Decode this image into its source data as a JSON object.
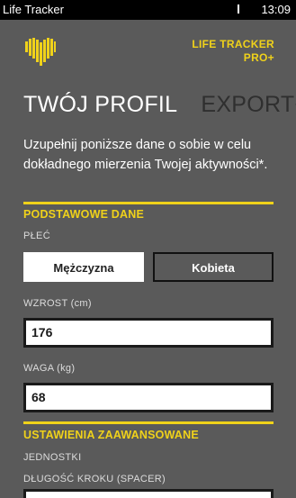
{
  "status_bar": {
    "app_title": "Life Tracker",
    "time": "13:09"
  },
  "brand": {
    "line1": "LIFE TRACKER",
    "line2": "PRO+"
  },
  "tabs": [
    {
      "label": "TWÓJ PROFIL",
      "active": true
    },
    {
      "label": "EXPORT+IMPORT",
      "active": false
    }
  ],
  "intro_text": "Uzupełnij poniższe dane o sobie w celu dokładnego mierzenia Twojej aktywności*.",
  "basic": {
    "section_title": "PODSTAWOWE DANE",
    "gender": {
      "label": "PŁEĆ",
      "male_label": "Mężczyzna",
      "female_label": "Kobieta",
      "selected": "Mężczyzna"
    },
    "height": {
      "label": "WZROST (cm)",
      "value": "176"
    },
    "weight": {
      "label": "WAGA (kg)",
      "value": "68"
    }
  },
  "advanced": {
    "section_title": "USTAWIENIA ZAAWANSOWANE",
    "units_label": "JEDNOSTKI",
    "step_label": "DŁUGOŚĆ KROKU (SPACER)"
  },
  "colors": {
    "accent": "#f0d21a",
    "background": "#5a5a5a",
    "inactive_tab": "#2f2f2f",
    "statusbar": "#000000"
  }
}
